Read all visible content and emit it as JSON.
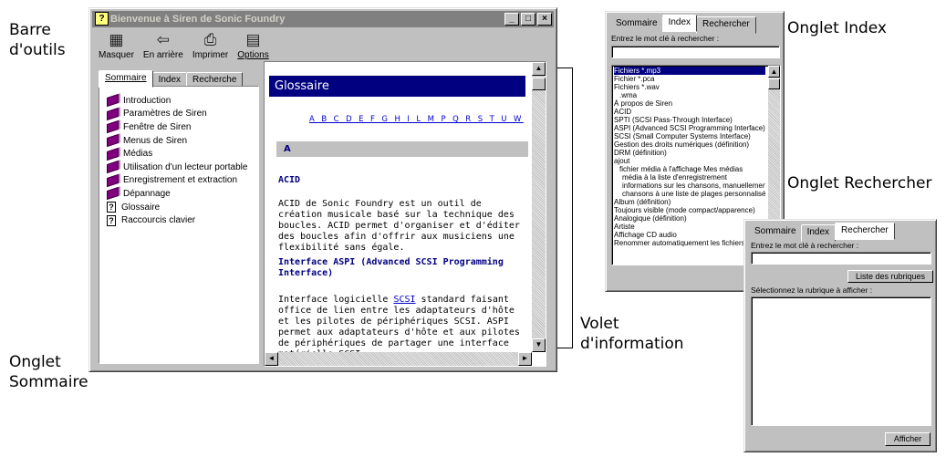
{
  "callouts": {
    "toolbar": "Barre\nd'outils",
    "contents_tab": "Onglet\nSommaire",
    "index_tab": "Onglet Index",
    "search_tab": "Onglet Rechercher",
    "info_pane": "Volet\nd'information"
  },
  "main_window": {
    "title": "Bienvenue à Siren de Sonic Foundry",
    "title_icon": "?",
    "window_buttons": [
      "_",
      "□",
      "×"
    ],
    "toolbar": [
      {
        "label": "Masquer",
        "icon": "hide-icon"
      },
      {
        "label": "En arrière",
        "icon": "back-arrow-icon"
      },
      {
        "label": "Imprimer",
        "icon": "printer-icon"
      },
      {
        "label": "Options",
        "icon": "options-icon"
      }
    ],
    "tabs": [
      "Sommaire",
      "Index",
      "Recherche"
    ],
    "tree": [
      {
        "label": "Introduction",
        "icon": "book-icon"
      },
      {
        "label": "Paramètres de Siren",
        "icon": "book-icon"
      },
      {
        "label": "Fenêtre de Siren",
        "icon": "book-icon"
      },
      {
        "label": "Menus de Siren",
        "icon": "book-icon"
      },
      {
        "label": "Médias",
        "icon": "book-icon"
      },
      {
        "label": "Utilisation d'un lecteur portable",
        "icon": "book-icon"
      },
      {
        "label": "Enregistrement et extraction",
        "icon": "book-icon"
      },
      {
        "label": "Dépannage",
        "icon": "book-icon"
      },
      {
        "label": "Glossaire",
        "icon": "help-page-icon"
      },
      {
        "label": "Raccourcis clavier",
        "icon": "help-page-icon"
      }
    ],
    "content": {
      "title": "Glossaire",
      "alphabet": "A B C D E F G H I L M P Q R S T U W",
      "section": "A",
      "term1": "ACID",
      "para1": "ACID de Sonic Foundry est un outil de création musicale basé sur la technique des boucles. ACID permet d'organiser et d'éditer des boucles afin d'offrir aux musiciens une flexibilité sans égale.",
      "term2": "Interface ASPI (Advanced SCSI Programming Interface)",
      "para2_pre": "Interface logicielle ",
      "para2_link": "SCSI",
      "para2_post": " standard faisant office de lien entre les adaptateurs d'hôte et les pilotes de périphériques SCSI. ASPI permet aux adaptateurs d'hôte et aux pilotes de périphériques de partager une interface matérielle SCSI."
    }
  },
  "index_panel": {
    "tabs": [
      "Sommaire",
      "Index",
      "Rechercher"
    ],
    "prompt": "Entrez le mot clé à rechercher :",
    "input_value": "",
    "items": [
      {
        "t": "Fichiers *.mp3",
        "c": "sel"
      },
      {
        "t": "Fichier *.pca",
        "c": ""
      },
      {
        "t": "Fichiers *.wav",
        "c": ""
      },
      {
        "t": ".wma",
        "c": "ind"
      },
      {
        "t": "À propos de Siren",
        "c": ""
      },
      {
        "t": "ACID",
        "c": ""
      },
      {
        "t": "SPTI (SCSI Pass-Through Interface)",
        "c": ""
      },
      {
        "t": "ASPI (Advanced SCSI Programming Interface)",
        "c": ""
      },
      {
        "t": "SCSI (Small Computer Systems Interface)",
        "c": ""
      },
      {
        "t": "Gestion des droits numériques (définition)",
        "c": ""
      },
      {
        "t": "DRM (définition)",
        "c": ""
      },
      {
        "t": "ajout",
        "c": ""
      },
      {
        "t": "fichier média à l'affichage Mes médias",
        "c": "ind"
      },
      {
        "t": "média à la liste d'enregistrement",
        "c": "ind2"
      },
      {
        "t": "informations sur les chansons, manuellement",
        "c": "ind2"
      },
      {
        "t": "chansons à une liste de plages personnalisée",
        "c": "ind2"
      },
      {
        "t": "Album (définition)",
        "c": ""
      },
      {
        "t": "Toujours visible (mode compact/apparence)",
        "c": ""
      },
      {
        "t": "Analogique (définition)",
        "c": ""
      },
      {
        "t": "Artiste",
        "c": ""
      },
      {
        "t": "Affichage CD audio",
        "c": ""
      },
      {
        "t": "Renommer automatiquement les fichiers",
        "c": ""
      }
    ]
  },
  "search_panel": {
    "tabs": [
      "Sommaire",
      "Index",
      "Rechercher"
    ],
    "prompt": "Entrez le mot clé à rechercher :",
    "input_value": "",
    "list_button": "Liste des rubriques",
    "select_label": "Sélectionnez la rubrique à afficher :",
    "display_button": "Afficher"
  }
}
